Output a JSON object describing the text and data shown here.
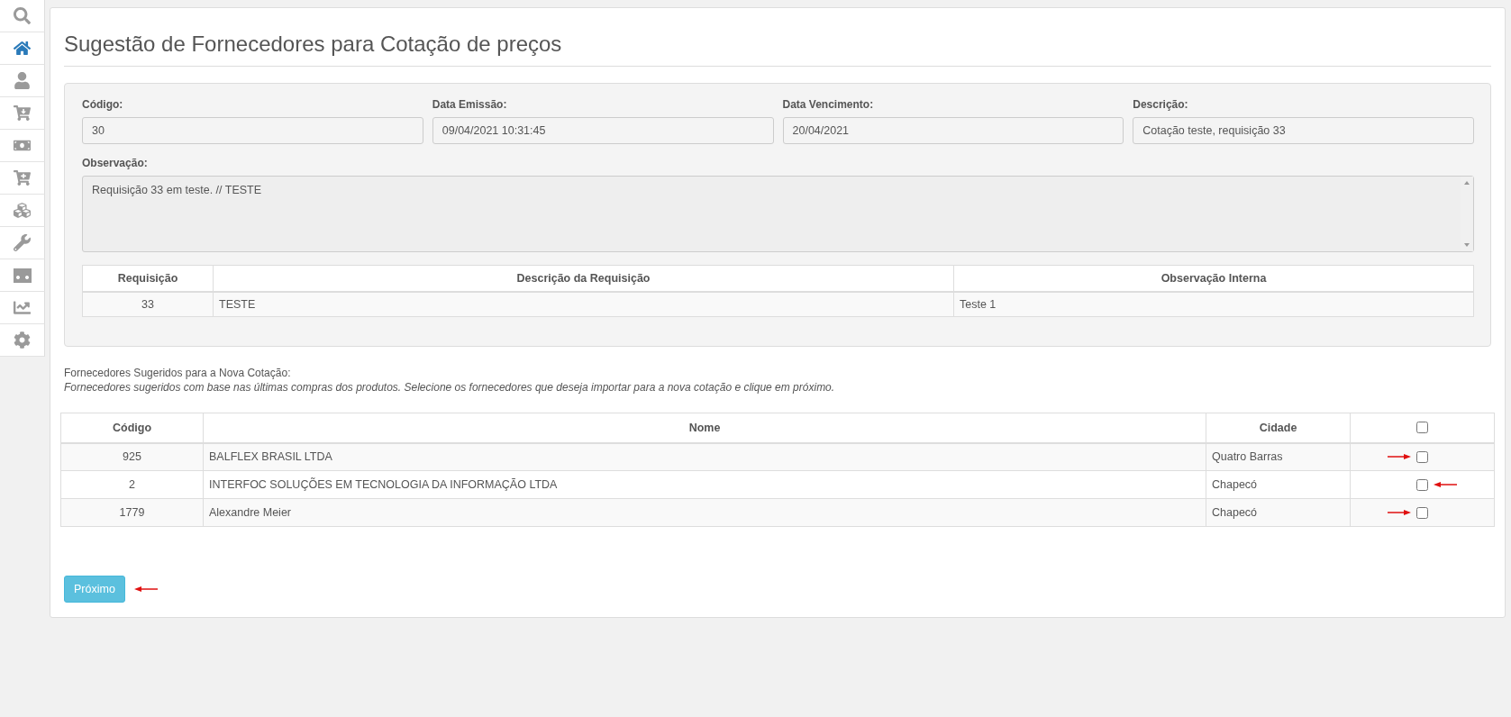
{
  "sidebar": {
    "items": [
      {
        "selected": false
      },
      {
        "selected": true
      },
      {
        "selected": false
      },
      {
        "selected": false
      },
      {
        "selected": false
      },
      {
        "selected": false
      },
      {
        "selected": false
      },
      {
        "selected": false
      },
      {
        "selected": false
      },
      {
        "selected": false
      },
      {
        "selected": false
      }
    ]
  },
  "title": "Sugestão de Fornecedores para Cotação de preços",
  "form": {
    "fields": [
      {
        "label": "Código:",
        "value": "30"
      },
      {
        "label": "Data Emissão:",
        "value": "09/04/2021 10:31:45"
      },
      {
        "label": "Data Vencimento:",
        "value": "20/04/2021"
      },
      {
        "label": "Descrição:",
        "value": "Cotação teste, requisição 33"
      }
    ],
    "observation": {
      "label": "Observação:",
      "value": "Requisição 33 em teste. // TESTE"
    },
    "requisitions": {
      "columns": [
        "Requisição",
        "Descrição da Requisição",
        "Observação Interna"
      ],
      "rows": [
        [
          "33",
          "TESTE",
          "Teste 1"
        ]
      ]
    }
  },
  "suppliers": {
    "heading": "Fornecedores Sugeridos para a Nova Cotação:",
    "hint": "Fornecedores sugeridos com base nas últimas compras dos produtos. Selecione os fornecedores que deseja importar para a nova cotação e clique em próximo.",
    "columns": [
      "Código",
      "Nome",
      "Cidade"
    ],
    "all_checked": false,
    "rows": [
      {
        "code": "925",
        "name": "BALFLEX BRASIL LTDA",
        "city": "Quatro Barras",
        "checked": false,
        "arrow_before": true,
        "arrow_after": false
      },
      {
        "code": "2",
        "name": "INTERFOC SOLUÇÕES EM TECNOLOGIA DA INFORMAÇÃO LTDA",
        "city": "Chapecó",
        "checked": false,
        "arrow_before": false,
        "arrow_after": true
      },
      {
        "code": "1779",
        "name": "Alexandre Meier",
        "city": "Chapecó",
        "checked": false,
        "arrow_before": true,
        "arrow_after": false
      }
    ]
  },
  "next_button": {
    "label": "Próximo",
    "arrow_after": true
  }
}
